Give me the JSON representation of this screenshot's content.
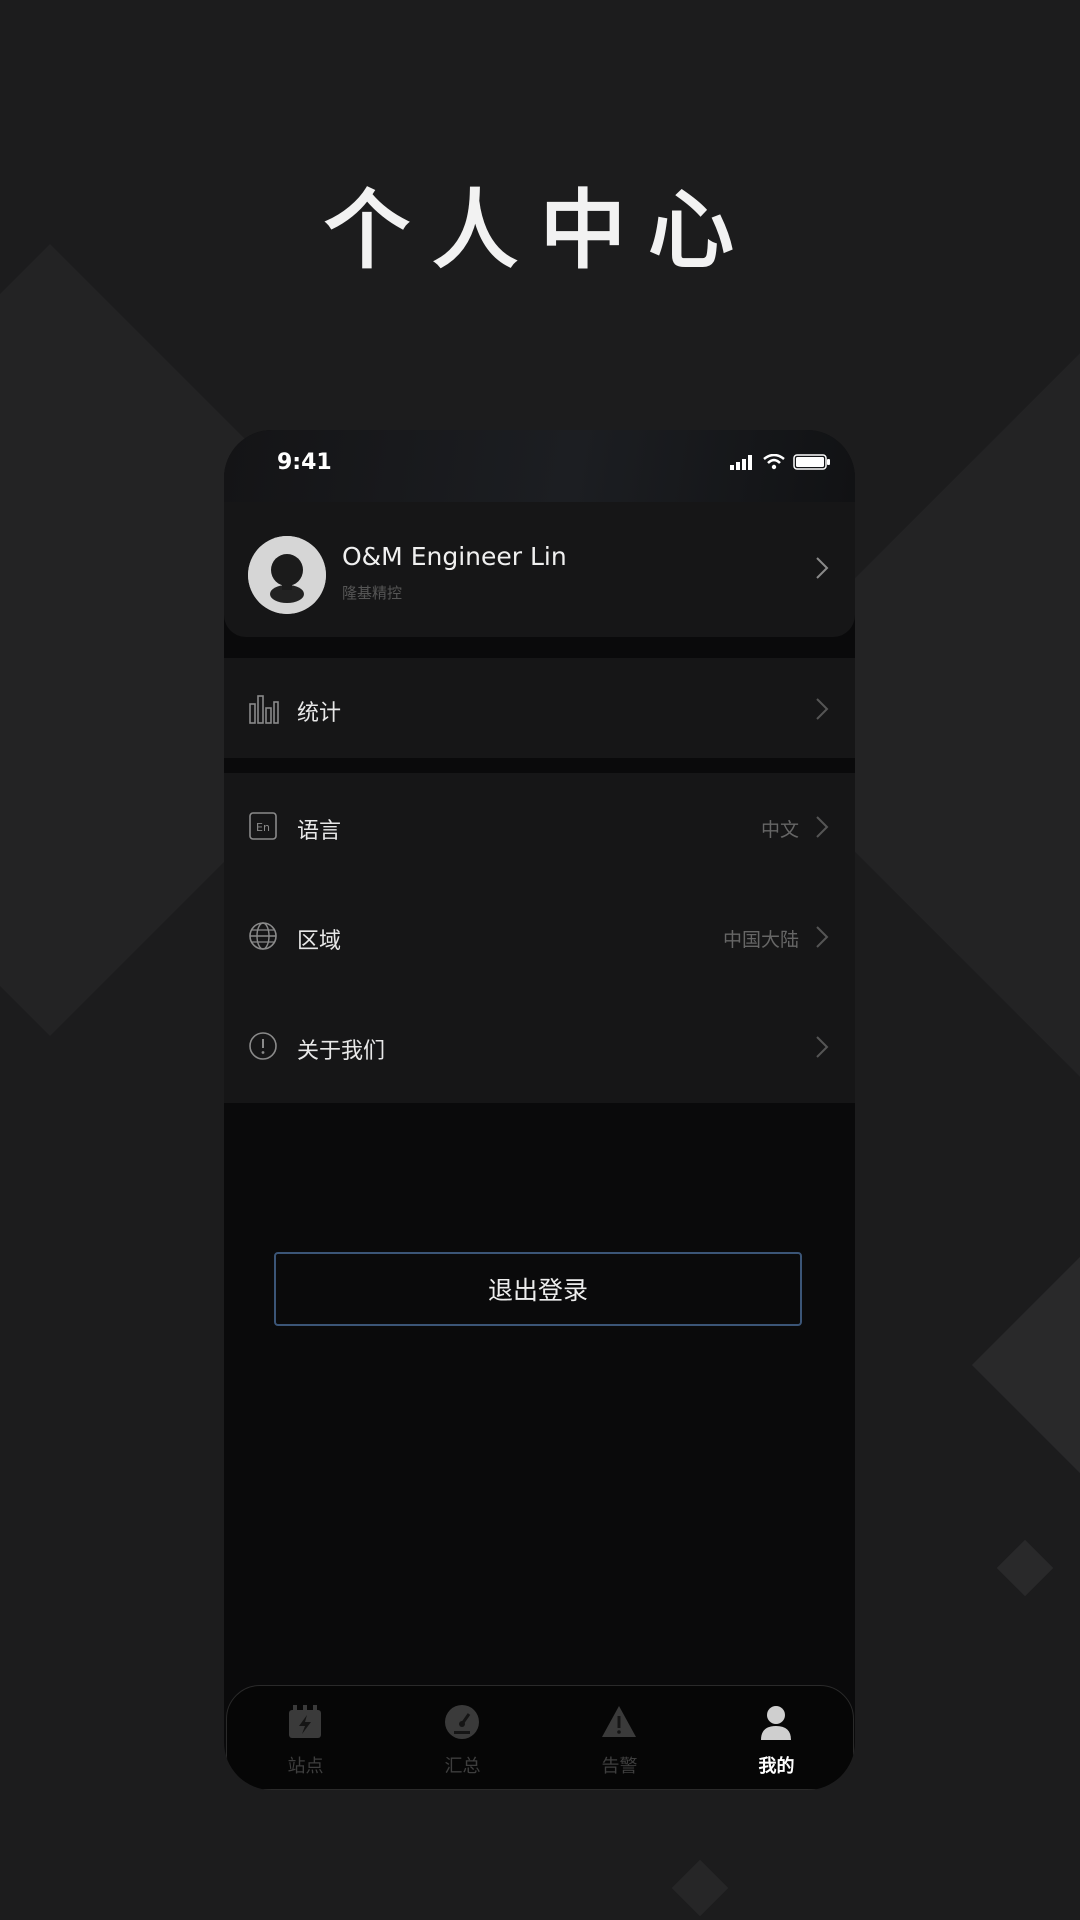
{
  "promo": {
    "title": "个人中心"
  },
  "status_bar": {
    "time": "9:41"
  },
  "profile": {
    "name": "O&M Engineer Lin",
    "company": "隆基精控"
  },
  "menu": {
    "stats": {
      "label": "统计"
    },
    "language": {
      "label": "语言",
      "value": "中文"
    },
    "region": {
      "label": "区域",
      "value": "中国大陆"
    },
    "about": {
      "label": "关于我们"
    }
  },
  "logout": {
    "label": "退出登录"
  },
  "tabs": [
    {
      "label": "站点",
      "icon": "station-icon"
    },
    {
      "label": "汇总",
      "icon": "dashboard-gauge-icon"
    },
    {
      "label": "告警",
      "icon": "alarm-warning-icon"
    },
    {
      "label": "我的",
      "icon": "user-profile-icon",
      "active": true
    }
  ],
  "colors": {
    "background": "#1c1c1d",
    "phone": "#0a0a0b",
    "row": "#161617",
    "accent_border": "#3b5577"
  }
}
